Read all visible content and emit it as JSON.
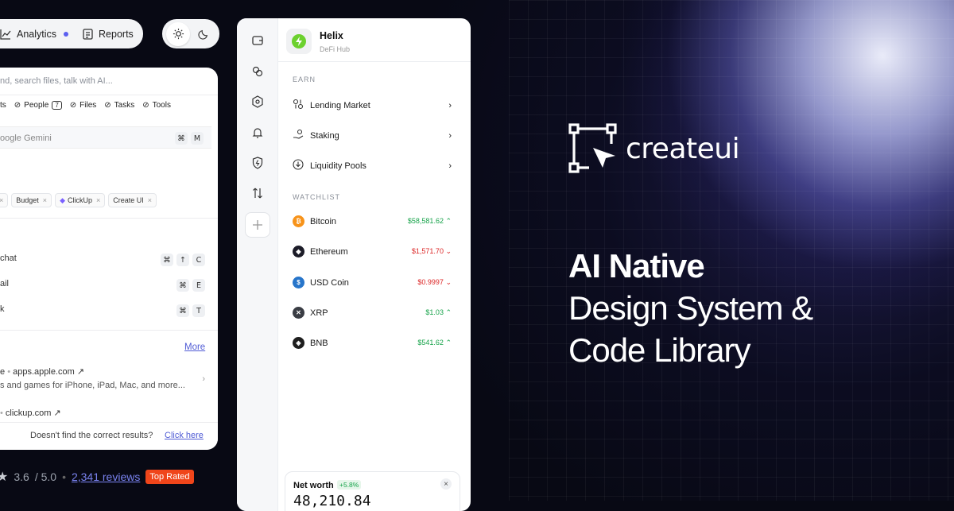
{
  "nav": {
    "analytics": "Analytics",
    "reports": "Reports"
  },
  "search": {
    "placeholder": "nd, search files, talk with AI...",
    "filters": [
      "ts",
      "People",
      "Files",
      "Tasks",
      "Tools"
    ],
    "people_count": "7",
    "gemini": "oogle Gemini",
    "tags": [
      "Budget",
      "ClickUp",
      "Create UI"
    ],
    "actions": [
      {
        "label": "chat",
        "keys": [
          "⌘",
          "↑",
          "C"
        ]
      },
      {
        "label": "ail",
        "keys": [
          "⌘",
          "E"
        ]
      },
      {
        "label": "k",
        "keys": [
          "⌘",
          "T"
        ]
      }
    ],
    "more": "More",
    "results": [
      {
        "prefix": "e",
        "domain": "apps.apple.com",
        "desc": "s and games for iPhone, iPad, Mac, and more..."
      },
      {
        "prefix": "",
        "domain": "clickup.com",
        "desc": ""
      }
    ],
    "footer_text": "Doesn't find the correct results?",
    "footer_link": "Click here"
  },
  "rating": {
    "score": "3.6",
    "total": "/ 5.0",
    "reviews": "2,341 reviews",
    "badge": "Top Rated"
  },
  "app": {
    "name": "Helix",
    "subtitle": "DeFi Hub",
    "earn_label": "EARN",
    "earn": [
      "Lending Market",
      "Staking",
      "Liquidity Pools"
    ],
    "watch_label": "WATCHLIST",
    "watchlist": [
      {
        "name": "Bitcoin",
        "price": "$58,581.62",
        "dir": "up",
        "color": "#f7931a",
        "icon": "bitcoin-icon"
      },
      {
        "name": "Ethereum",
        "price": "$1,571.70",
        "dir": "down",
        "color": "#1c1c28",
        "icon": "ethereum-icon"
      },
      {
        "name": "USD Coin",
        "price": "$0.9997",
        "dir": "down",
        "color": "#2775ca",
        "icon": "usdc-icon"
      },
      {
        "name": "XRP",
        "price": "$1.03",
        "dir": "up",
        "color": "#3a3d44",
        "icon": "xrp-icon"
      },
      {
        "name": "BNB",
        "price": "$541.62",
        "dir": "up",
        "color": "#1e1e1e",
        "icon": "bnb-icon"
      }
    ],
    "networth_label": "Net worth",
    "networth_change": "+5.8%",
    "networth_value": "48,210.84"
  },
  "brand": {
    "name": "createui"
  },
  "headline": {
    "line1": "AI Native",
    "line2": "Design System &",
    "line3": "Code Library"
  }
}
